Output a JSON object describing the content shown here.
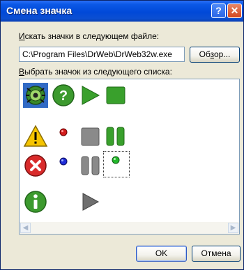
{
  "window": {
    "title": "Смена значка"
  },
  "labels": {
    "search_prefix": "И",
    "search_rest": "скать значки в следующем файле:",
    "select_prefix": "В",
    "select_rest": "ыбрать значок из следующего списка:"
  },
  "file_path": "C:\\Program Files\\DrWeb\\DrWeb32w.exe",
  "buttons": {
    "browse_label_a": "Об",
    "browse_label_u": "з",
    "browse_label_b": "ор...",
    "ok": "OK",
    "cancel": "Отмена",
    "help_glyph": "?",
    "close_glyph": "✕"
  },
  "scroll": {
    "left": "◀",
    "right": "▶"
  },
  "icons": [
    "drweb-spider-icon",
    "help-icon",
    "play-icon",
    "stop-icon",
    "warning-icon",
    "red-dot-icon",
    "stop-gray-icon",
    "pause-green-icon",
    "error-icon",
    "blue-dot-icon",
    "pause-gray-icon",
    "green-dot-icon",
    "info-icon",
    "play-gray-icon"
  ],
  "selected_icon": "drweb-spider-icon",
  "focused_icon": "green-dot-icon"
}
